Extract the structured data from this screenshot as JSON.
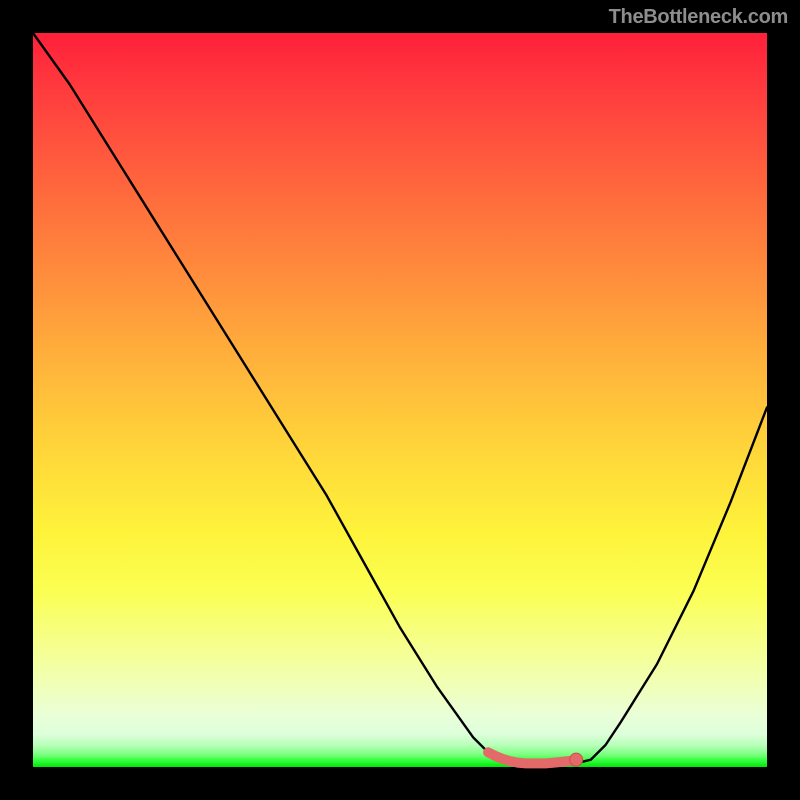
{
  "watermark": "TheBottleneck.com",
  "colors": {
    "curve": "#000000",
    "marker_fill": "#e46a6a",
    "marker_stroke": "#c94f50",
    "background": "#000000"
  },
  "chart_data": {
    "type": "line",
    "title": "",
    "xlabel": "",
    "ylabel": "",
    "xlim": [
      0,
      100
    ],
    "ylim": [
      0,
      100
    ],
    "grid": false,
    "legend": false,
    "series": [
      {
        "name": "bottleneck-curve",
        "x": [
          0,
          5,
          10,
          15,
          20,
          25,
          30,
          35,
          40,
          45,
          50,
          55,
          60,
          62,
          64,
          66,
          68,
          70,
          72,
          74,
          76,
          78,
          80,
          85,
          90,
          95,
          100
        ],
        "values": [
          100,
          93,
          85,
          77,
          69,
          61,
          53,
          45,
          37,
          28,
          19,
          11,
          4,
          2,
          1,
          0.5,
          0.5,
          0.5,
          0.5,
          0.5,
          1,
          3,
          6,
          14,
          24,
          36,
          49
        ]
      }
    ],
    "annotations": [
      {
        "name": "optimal-segment",
        "kind": "highlight-line",
        "x": [
          62,
          63,
          64,
          65,
          66,
          67,
          68,
          69,
          70,
          71,
          72,
          73,
          74
        ],
        "values": [
          2.0,
          1.5,
          1.1,
          0.8,
          0.6,
          0.5,
          0.5,
          0.5,
          0.5,
          0.6,
          0.7,
          0.8,
          1.0
        ]
      },
      {
        "name": "optimal-point",
        "kind": "marker",
        "x": 74,
        "value": 1.0
      }
    ]
  }
}
